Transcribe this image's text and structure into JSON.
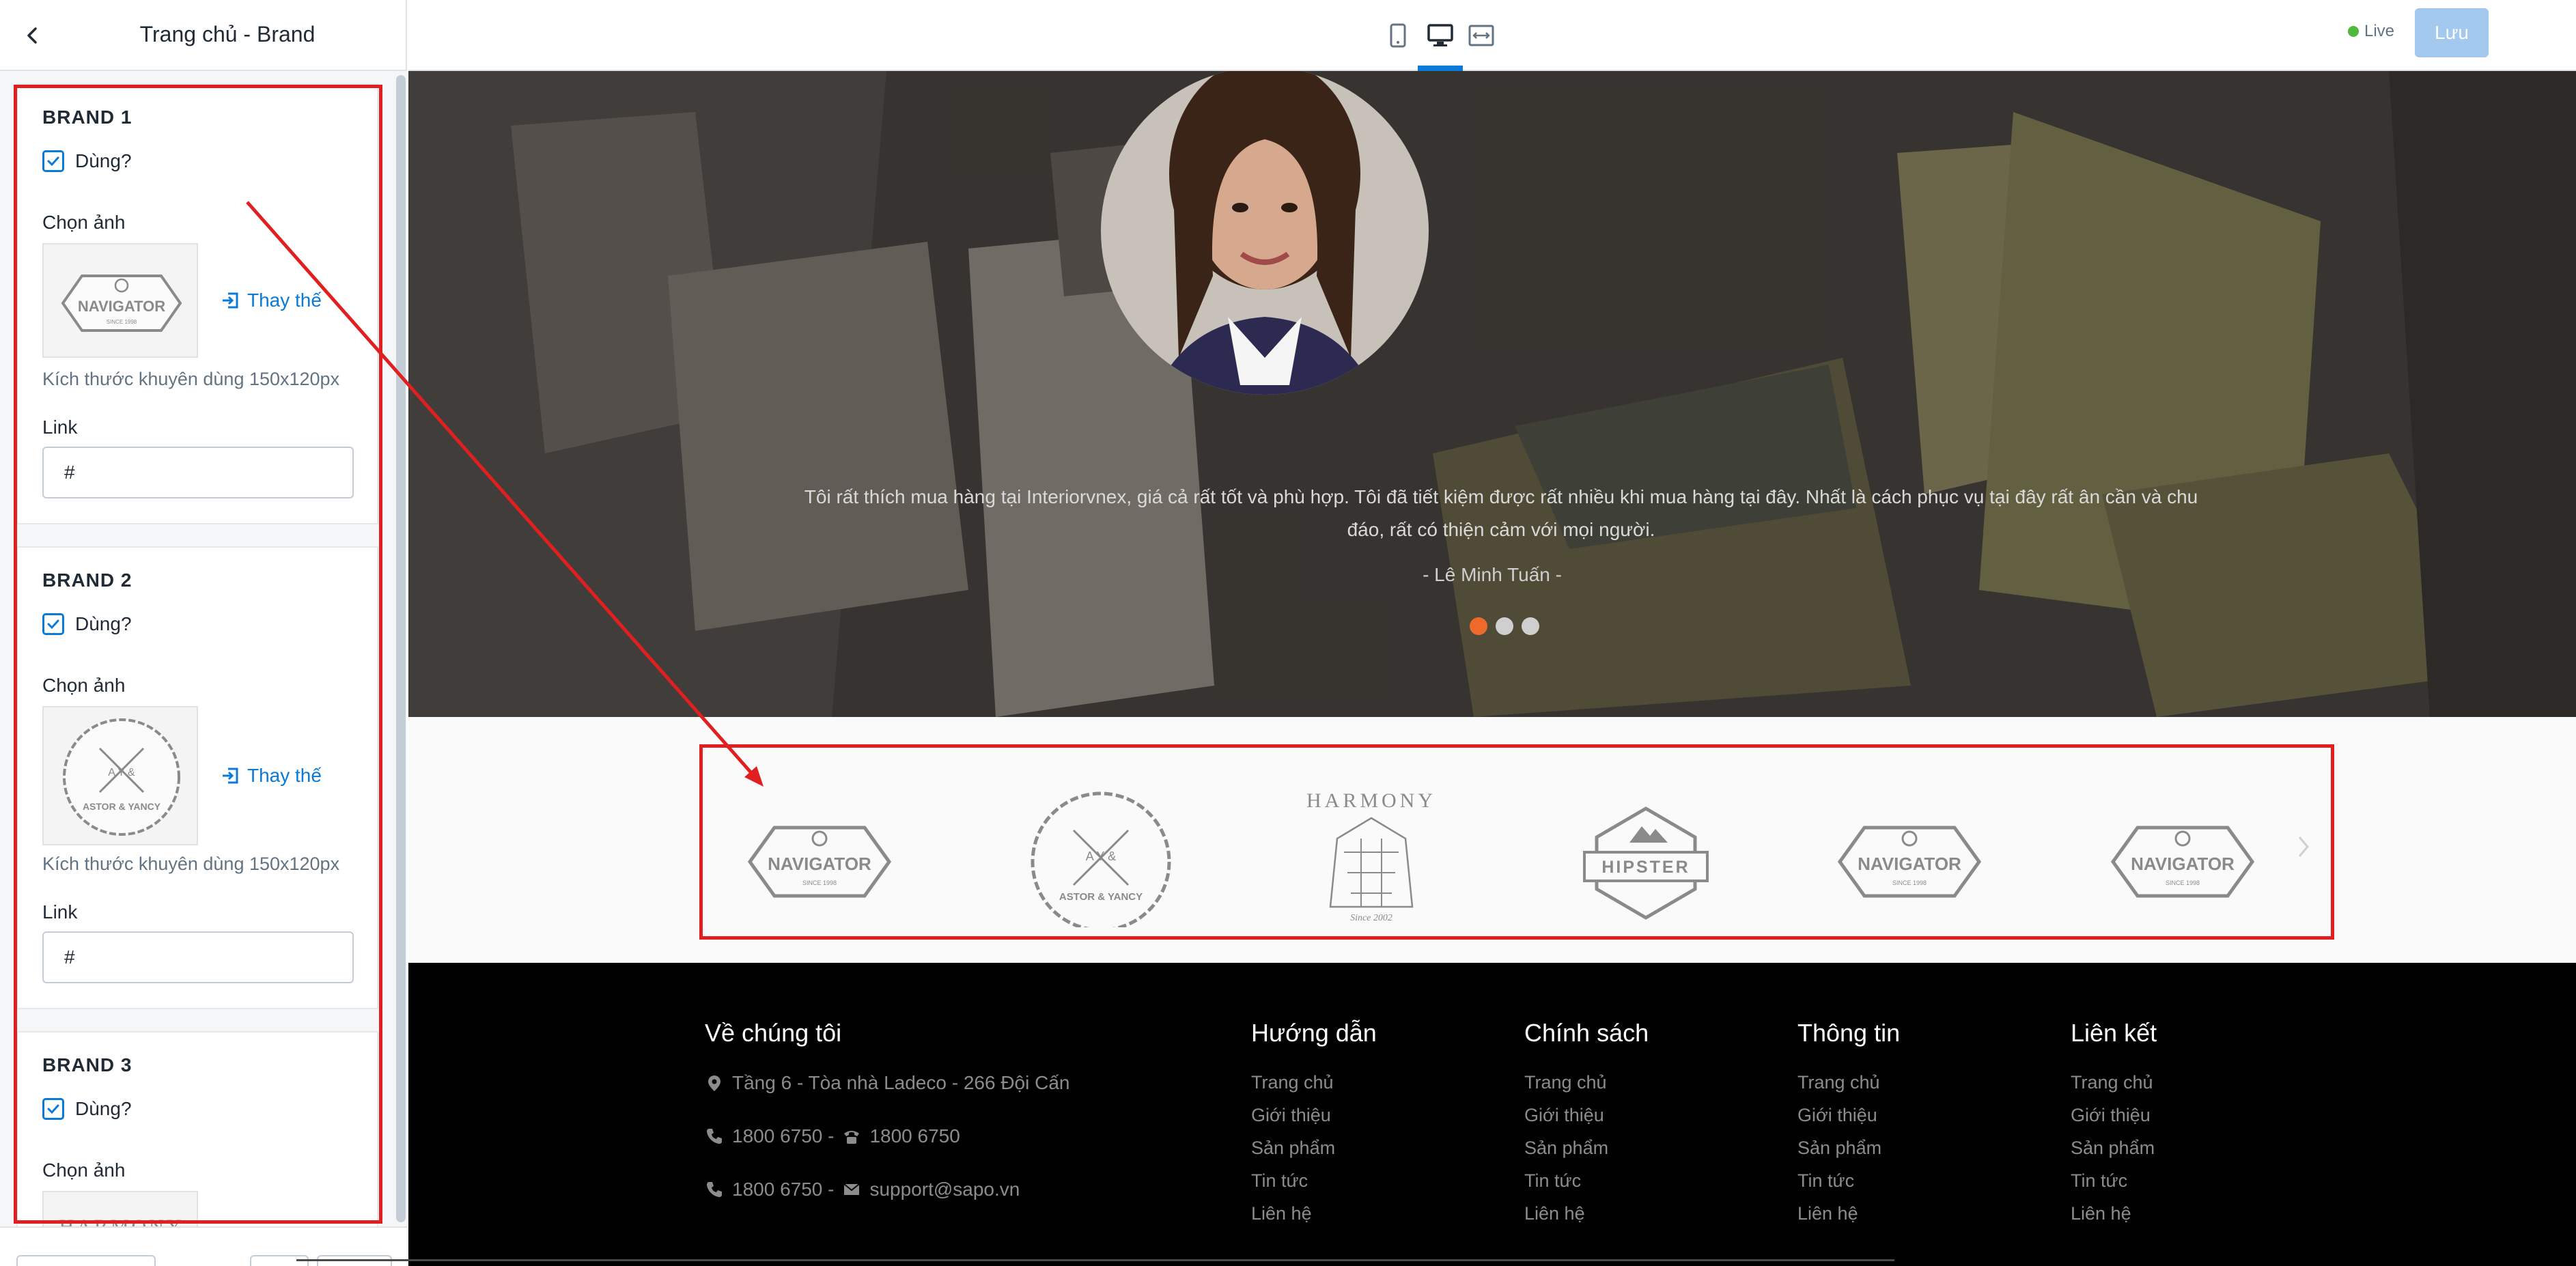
{
  "sidebar": {
    "title": "Trang chủ - Brand",
    "brands": [
      {
        "heading": "BRAND 1",
        "use_label": "Dùng?",
        "image_label": "Chọn ảnh",
        "replace_label": "Thay thế",
        "hint": "Kích thước khuyên dùng 150x120px",
        "link_label": "Link",
        "link_value": "#",
        "logo_text": "NAVIGATOR",
        "logo_sub": "SINCE 1998"
      },
      {
        "heading": "BRAND 2",
        "use_label": "Dùng?",
        "image_label": "Chọn ảnh",
        "replace_label": "Thay thế",
        "hint": "Kích thước khuyên dùng 150x120px",
        "link_label": "Link",
        "link_value": "#",
        "logo_text": "ASTOR & YANCY",
        "logo_sub": "A Y &"
      },
      {
        "heading": "BRAND 3",
        "use_label": "Dùng?",
        "image_label": "Chọn ảnh",
        "logo_text": "HARMONY"
      }
    ]
  },
  "topbar": {
    "live_label": "Live",
    "save_label": "Lưu"
  },
  "hero": {
    "testimonial": "Tôi rất thích mua hàng tại Interiorvnex, giá cả rất tốt và phù hợp. Tôi đã tiết kiệm được rất nhiều khi mua hàng tại đây. Nhất là cách phục vụ tại đây rất ân cần và chu đáo, rất có thiện cảm với mọi người.",
    "author": "- Lê Minh Tuấn -"
  },
  "brand_logos": [
    {
      "main": "NAVIGATOR",
      "sub": "SINCE 1998"
    },
    {
      "main": "ASTOR & YANCY",
      "sub": "A Y &"
    },
    {
      "main": "HARMONY",
      "sub": "Since 2002"
    },
    {
      "main": "HIPSTER",
      "sub": ""
    },
    {
      "main": "NAVIGATOR",
      "sub": "SINCE 1998"
    },
    {
      "main": "NAVIGATOR",
      "sub": "SINCE 1998"
    }
  ],
  "footer": {
    "about": {
      "title": "Về chúng tôi",
      "address": "Tầng 6 - Tòa nhà Ladeco - 266 Đội Cấn",
      "phone_a": "1800 6750 -",
      "phone_b": "1800 6750",
      "phone_c": "1800 6750 -",
      "email": "support@sapo.vn"
    },
    "columns": [
      {
        "title": "Hướng dẫn",
        "links": [
          "Trang chủ",
          "Giới thiệu",
          "Sản phẩm",
          "Tin tức",
          "Liên hệ"
        ]
      },
      {
        "title": "Chính sách",
        "links": [
          "Trang chủ",
          "Giới thiệu",
          "Sản phẩm",
          "Tin tức",
          "Liên hệ"
        ]
      },
      {
        "title": "Thông tin",
        "links": [
          "Trang chủ",
          "Giới thiệu",
          "Sản phẩm",
          "Tin tức",
          "Liên hệ"
        ]
      },
      {
        "title": "Liên kết",
        "links": [
          "Trang chủ",
          "Giới thiệu",
          "Sản phẩm",
          "Tin tức",
          "Liên hệ"
        ]
      }
    ]
  },
  "colors": {
    "accent": "#0a7ad8",
    "annotation": "#e02020",
    "save_button": "#a4c9ee",
    "slider_active": "#ee6a2b"
  }
}
